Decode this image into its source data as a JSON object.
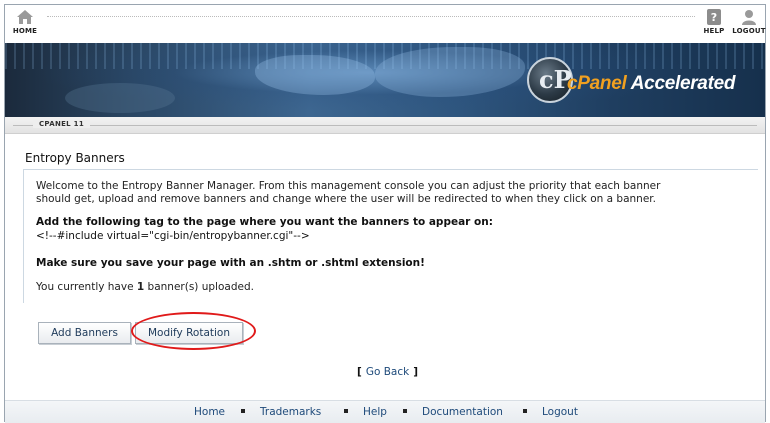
{
  "nav": {
    "home_label": "HOME",
    "help_label": "HELP",
    "logout_label": "LOGOUT"
  },
  "banner": {
    "brand_prefix": "cPanel",
    "brand_suffix": "Accelerated",
    "logo_letter": "cP"
  },
  "version_label": "CPANEL 11",
  "page": {
    "title": "Entropy Banners",
    "welcome_line1": "Welcome to the Entropy Banner Manager. From this management console you can adjust the priority that each banner",
    "welcome_line2": "should get, upload and remove banners and change where the user will be redirected to when they click on a banner.",
    "tag_instruction": "Add the following tag to the page where you want the banners to appear on:",
    "tag_code": "<!--#include virtual=\"cgi-bin/entropybanner.cgi\"-->",
    "save_notice": "Make sure you save your page with an .shtm or .shtml extension!",
    "count_prefix": "You currently have ",
    "count_value": "1",
    "count_suffix": " banner(s) uploaded."
  },
  "buttons": {
    "add_banners": "Add Banners",
    "modify_rotation": "Modify Rotation"
  },
  "goback": {
    "open": "[",
    "label": "Go Back",
    "close": "]"
  },
  "footer": {
    "links": [
      "Home",
      "Trademarks",
      "Help",
      "Documentation",
      "Logout"
    ]
  },
  "colors": {
    "link": "#1e4a7a",
    "highlight_ring": "#e01a1a",
    "brand_accent": "#f0a020"
  }
}
